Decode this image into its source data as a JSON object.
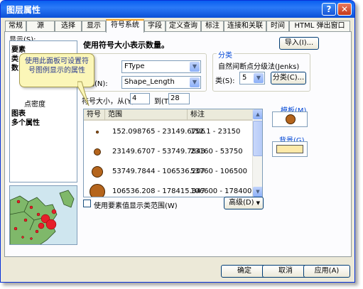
{
  "window": {
    "title": "图层属性"
  },
  "titlebar_buttons": {
    "help": "?",
    "close": "✕"
  },
  "tabs": [
    {
      "label": "常规"
    },
    {
      "label": "源"
    },
    {
      "label": "选择"
    },
    {
      "label": "显示"
    },
    {
      "label": "符号系统",
      "active": true
    },
    {
      "label": "字段"
    },
    {
      "label": "定义查询"
    },
    {
      "label": "标注"
    },
    {
      "label": "连接和关联"
    },
    {
      "label": "时间"
    },
    {
      "label": "HTML 弹出窗口"
    }
  ],
  "show_panel": {
    "label": "显示(S):",
    "items": [
      "要素",
      "类",
      "数",
      "点密度",
      "图表",
      "多个属性"
    ]
  },
  "tooltip": {
    "text": "使用此面板可设置符号图例显示的属性"
  },
  "main": {
    "heading": "使用符号大小表示数量。",
    "import_button": "导入(I)...",
    "field_value_select": "FType",
    "normalize_label": "化(N):",
    "normalize_select": "Shape_Length",
    "classification": {
      "legend": "分类",
      "method": "自然间断点分级法(Jenks)",
      "classes_label": "类(S):",
      "classes_value": "5",
      "classify_button": "分类(C)..."
    },
    "size_range": {
      "label": "符号大小，从(Y)",
      "from": "4",
      "to_label": "到(T)",
      "to": "28"
    },
    "table": {
      "headers": {
        "symbol": "符号",
        "range": "范围",
        "label": "标注"
      },
      "rows": [
        {
          "range": "152.098765 - 23149.6706",
          "label": "152.1 - 23150",
          "size": 4
        },
        {
          "range": "23149.6707 - 53749.7843",
          "label": "23160 - 53750",
          "size": 10
        },
        {
          "range": "53749.7844 - 106536.207",
          "label": "53760 - 106500",
          "size": 16
        },
        {
          "range": "106536.208 - 178415.347",
          "label": "106600 - 178400",
          "size": 22
        }
      ]
    },
    "template_label": "模板(M)",
    "background_label": "背景(G)",
    "checkbox_label": "使用要素值显示类范围(W)",
    "advanced_button": "高级(D)"
  },
  "footer": {
    "ok": "确定",
    "cancel": "取消",
    "apply": "应用(A)"
  },
  "colors": {
    "symbol_fill": "#b5651d",
    "background_fill": "#fde9a8",
    "tooltip_bg": "#fbf6b8",
    "tab_accent": "#f6a520"
  }
}
